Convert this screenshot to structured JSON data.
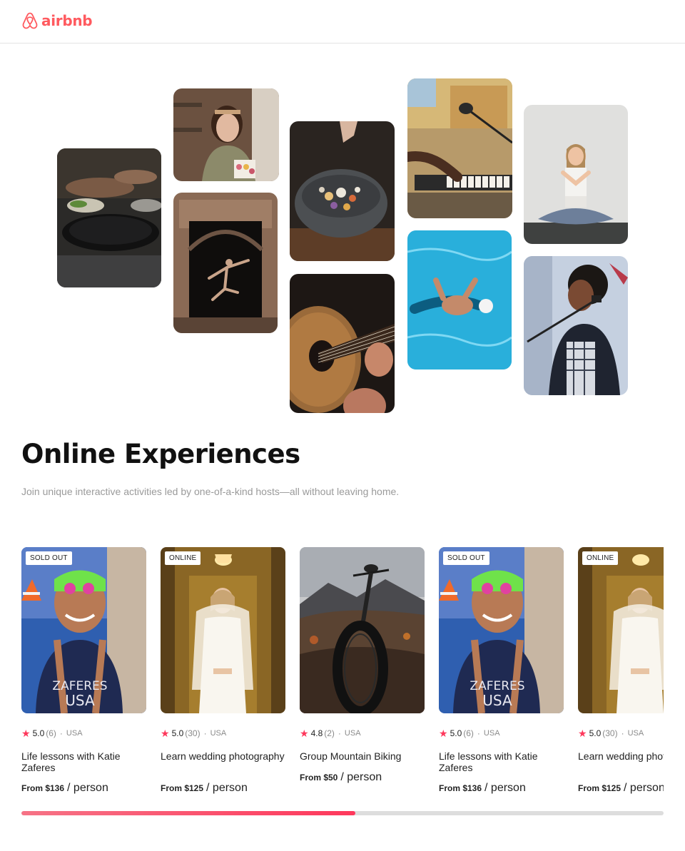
{
  "brand": {
    "name": "airbnb",
    "color": "#ff5a5f"
  },
  "hero": {
    "tiles": [
      {
        "name": "cooking-photo"
      },
      {
        "name": "macarons-host-photo"
      },
      {
        "name": "dancer-doorway-photo"
      },
      {
        "name": "spice-bowl-photo"
      },
      {
        "name": "acoustic-guitar-photo"
      },
      {
        "name": "piano-microphone-photo"
      },
      {
        "name": "swimmer-pool-photo"
      },
      {
        "name": "yoga-photo"
      },
      {
        "name": "singer-microphone-photo"
      }
    ]
  },
  "section": {
    "title": "Online Experiences",
    "subtitle": "Join unique interactive activities led by one-of-a-kind hosts—all without leaving home."
  },
  "cards": [
    {
      "badge": "SOLD OUT",
      "rating": "5.0",
      "count": "(6)",
      "country": "USA",
      "title": "Life lessons with Katie Zaferes",
      "price": "From $136",
      "unit": "/ person",
      "image": "swimmer-portrait"
    },
    {
      "badge": "ONLINE",
      "rating": "5.0",
      "count": "(30)",
      "country": "USA",
      "title": "Learn wedding photography",
      "price": "From $125",
      "unit": "/ person",
      "image": "bride-portrait"
    },
    {
      "badge": "",
      "rating": "4.8",
      "count": "(2)",
      "country": "USA",
      "title": "Group Mountain Biking",
      "price": "From $50",
      "unit": "/ person",
      "image": "mountain-bike"
    },
    {
      "badge": "SOLD OUT",
      "rating": "5.0",
      "count": "(6)",
      "country": "USA",
      "title": "Life lessons with Katie Zaferes",
      "price": "From $136",
      "unit": "/ person",
      "image": "swimmer-portrait"
    },
    {
      "badge": "ONLINE",
      "rating": "5.0",
      "count": "(30)",
      "country": "USA",
      "title": "Learn wedding photography",
      "price": "From $125",
      "unit": "/ person",
      "image": "bride-portrait"
    }
  ],
  "carousel": {
    "progress": 0.52,
    "accent": "#fe385c"
  }
}
